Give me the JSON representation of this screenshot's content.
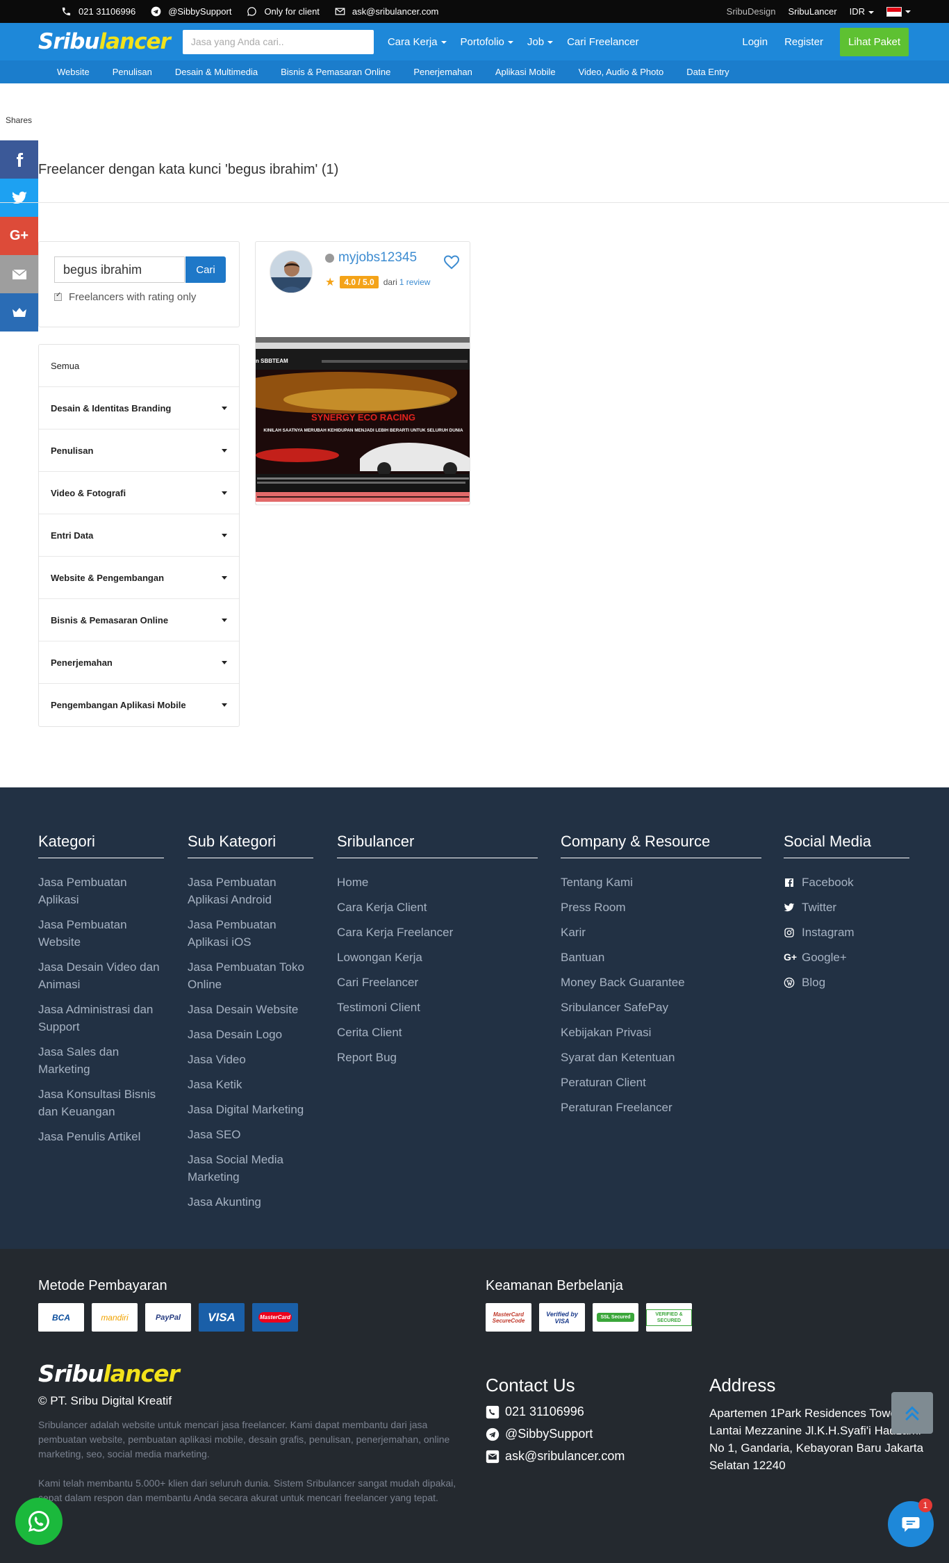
{
  "topbar": {
    "phone": "021 31106996",
    "telegram": "@SibbySupport",
    "whatsapp": "Only for client",
    "email": "ask@sribulancer.com",
    "sribudesign": "SribuDesign",
    "sribulancer": "SribuLancer",
    "currency": "IDR"
  },
  "header": {
    "logo_a": "Sribu",
    "logo_b": "lancer",
    "search_placeholder": "Jasa yang Anda cari..",
    "nav": [
      "Cara Kerja",
      "Portofolio",
      "Job",
      "Cari Freelancer"
    ],
    "login": "Login",
    "register": "Register",
    "paket": "Lihat Paket"
  },
  "subnav": [
    "Website",
    "Penulisan",
    "Desain & Multimedia",
    "Bisnis & Pemasaran Online",
    "Penerjemahan",
    "Aplikasi Mobile",
    "Video, Audio & Photo",
    "Data Entry"
  ],
  "shares": {
    "label": "Shares",
    "colors": {
      "facebook": "#3b5998",
      "twitter": "#1da1f2",
      "google": "#dd4b39",
      "email": "#9e9e9e",
      "crown": "#2a6cb5"
    }
  },
  "main": {
    "title": "Freelancer dengan kata kunci 'begus ibrahim' (1)",
    "keyword": "begus ibrahim",
    "cari": "Cari",
    "rating_only": "Freelancers with rating only",
    "categories": [
      "Semua",
      "Desain & Identitas Branding",
      "Penulisan",
      "Video & Fotografi",
      "Entri Data",
      "Website & Pengembangan",
      "Bisnis & Pemasaran Online",
      "Penerjemahan",
      "Pengembangan Aplikasi Mobile"
    ]
  },
  "card": {
    "username": "myjobs12345",
    "rating": "4.0 / 5.0",
    "dari": "dari",
    "review": "1 review",
    "shot_brand": "n SBBTEAM",
    "shot_heading": "SYNERGY ECO RACING",
    "shot_sub": "KINILAH SAATNYA MERUBAH KEHIDUPAN MENJADI LEBIH BERARTI UNTUK SELURUH DUNIA"
  },
  "footer": {
    "kategori": {
      "title": "Kategori",
      "items": [
        "Jasa Pembuatan Aplikasi",
        "Jasa Pembuatan Website",
        "Jasa Desain Video dan Animasi",
        "Jasa Administrasi dan Support",
        "Jasa Sales dan Marketing",
        "Jasa Konsultasi Bisnis dan Keuangan",
        "Jasa Penulis Artikel"
      ]
    },
    "subkategori": {
      "title": "Sub Kategori",
      "items": [
        "Jasa Pembuatan Aplikasi Android",
        "Jasa Pembuatan Aplikasi iOS",
        "Jasa Pembuatan Toko Online",
        "Jasa Desain Website",
        "Jasa Desain Logo",
        "Jasa Video",
        "Jasa Ketik",
        "Jasa Digital Marketing",
        "Jasa SEO",
        "Jasa Social Media Marketing",
        "Jasa Akunting"
      ]
    },
    "sribulancer": {
      "title": "Sribulancer",
      "items": [
        "Home",
        "Cara Kerja Client",
        "Cara Kerja Freelancer",
        "Lowongan Kerja",
        "Cari Freelancer",
        "Testimoni Client",
        "Cerita Client",
        "Report Bug"
      ]
    },
    "company": {
      "title": "Company & Resource",
      "items": [
        "Tentang Kami",
        "Press Room",
        "Karir",
        "Bantuan",
        "Money Back Guarantee",
        "Sribulancer SafePay",
        "Kebijakan Privasi",
        "Syarat dan Ketentuan",
        "Peraturan Client",
        "Peraturan Freelancer"
      ]
    },
    "social": {
      "title": "Social Media",
      "items": [
        "Facebook",
        "Twitter",
        "Instagram",
        "Google+",
        "Blog"
      ]
    }
  },
  "bottom": {
    "payment_title": "Metode Pembayaran",
    "payments": [
      "BCA",
      "mandiri",
      "PayPal",
      "VISA",
      "MasterCard"
    ],
    "security_title": "Keamanan Berbelanja",
    "security": [
      "MasterCard SecureCode",
      "Verified by VISA",
      "SSL Secured",
      "VERIFIED & SECURED"
    ],
    "copyright": "© PT. Sribu Digital Kreatif",
    "desc1": "Sribulancer adalah website untuk mencari jasa freelancer. Kami dapat membantu dari jasa pembuatan website, pembuatan aplikasi mobile, desain grafis, penulisan, penerjemahan, online marketing, seo, social media marketing.",
    "desc2": "Kami telah membantu 5.000+ klien dari seluruh dunia. Sistem Sribulancer sangat mudah dipakai, cepat dalam respon dan membantu Anda secara akurat untuk mencari freelancer yang tepat.",
    "contact_title": "Contact Us",
    "contact_phone": "021 31106996",
    "contact_telegram": "@SibbySupport",
    "contact_email": "ask@sribulancer.com",
    "address_title": "Address",
    "address": "Apartemen 1Park Residences Tower A, Lantai Mezzanine Jl.K.H.Syafi'i Hadzami No 1, Gandaria, Kebayoran Baru Jakarta Selatan 12240",
    "chat_count": "1"
  }
}
